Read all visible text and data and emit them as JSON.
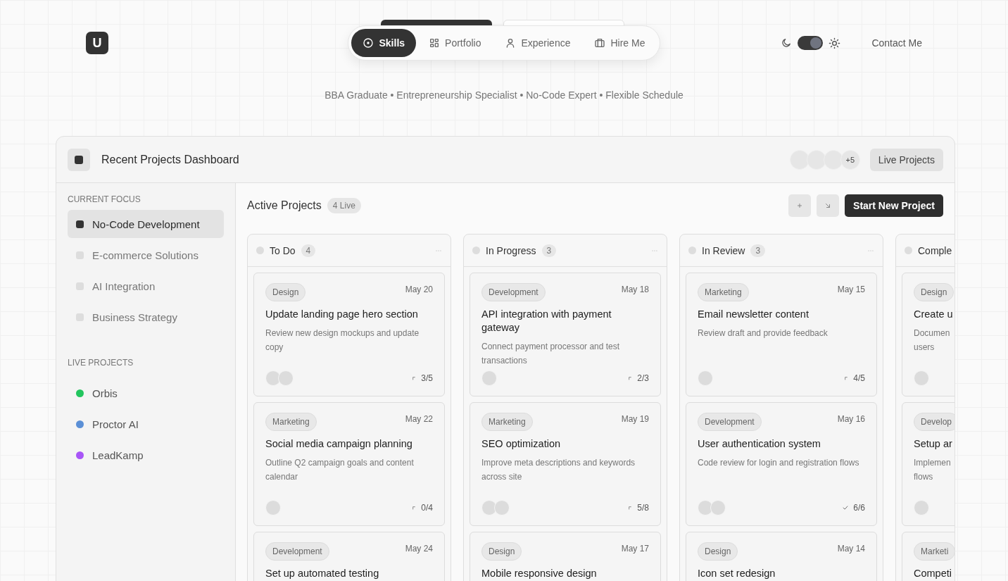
{
  "logo": {
    "letter": "U"
  },
  "nav": [
    {
      "label": "Skills",
      "selected": true
    },
    {
      "label": "Portfolio",
      "selected": false
    },
    {
      "label": "Experience",
      "selected": false
    },
    {
      "label": "Hire Me",
      "selected": false
    }
  ],
  "theme_toggle": {
    "on": true
  },
  "contact": {
    "label": "Contact Me"
  },
  "tagline": "BBA Graduate • Entrepreneurship Specialist • No-Code Expert • Flexible Schedule",
  "dashboard": {
    "title": "Recent Projects Dashboard",
    "team": {
      "avatars": [
        {
          "kind": "blank"
        },
        {
          "kind": "blank"
        },
        {
          "kind": "blank"
        }
      ],
      "more": "+5"
    },
    "live_button": "Live Projects",
    "sidebar": {
      "sections": [
        {
          "label": "CURRENT FOCUS",
          "kind": "focus",
          "items": [
            {
              "label": "No-Code Development",
              "selected": true
            },
            {
              "label": "E-commerce Solutions",
              "selected": false
            },
            {
              "label": "AI Integration",
              "selected": false
            },
            {
              "label": "Business Strategy",
              "selected": false
            }
          ]
        },
        {
          "label": "LIVE PROJECTS",
          "kind": "projects",
          "items": [
            {
              "label": "Orbis",
              "color": "#22c55e"
            },
            {
              "label": "Proctor AI",
              "color": "#5b8fd6"
            },
            {
              "label": "LeadKamp",
              "color": "#a855f7"
            }
          ]
        }
      ]
    },
    "board": {
      "title": "Active Projects",
      "badge": "4 Live",
      "new_button": "Start New Project",
      "columns": [
        {
          "title": "To Do",
          "count": "4",
          "cards": [
            {
              "tag": "Design",
              "date": "May 20",
              "title": "Update landing page hero section",
              "desc": "Review new design mockups and update copy",
              "avatars": [
                {
                  "kind": "blank"
                },
                {
                  "kind": "blank"
                }
              ],
              "progress": "3/5",
              "complete": false
            },
            {
              "tag": "Marketing",
              "date": "May 22",
              "title": "Social media campaign planning",
              "desc": "Outline Q2 campaign goals and content calendar",
              "avatars": [
                {
                  "kind": "blank"
                }
              ],
              "progress": "0/4",
              "complete": false
            },
            {
              "tag": "Development",
              "date": "May 24",
              "title": "Set up automated testing"
            }
          ]
        },
        {
          "title": "In Progress",
          "count": "3",
          "cards": [
            {
              "tag": "Development",
              "date": "May 18",
              "title": "API integration with payment gateway",
              "desc": "Connect payment processor and test transactions",
              "avatars": [
                {
                  "kind": "blank"
                }
              ],
              "progress": "2/3",
              "complete": false
            },
            {
              "tag": "Marketing",
              "date": "May 19",
              "title": "SEO optimization",
              "desc": "Improve meta descriptions and keywords across site",
              "avatars": [
                {
                  "kind": "blank"
                },
                {
                  "kind": "blank"
                }
              ],
              "progress": "5/8",
              "complete": false
            },
            {
              "tag": "Design",
              "date": "May 17",
              "title": "Mobile responsive design"
            }
          ]
        },
        {
          "title": "In Review",
          "count": "3",
          "cards": [
            {
              "tag": "Marketing",
              "date": "May 15",
              "title": "Email newsletter content",
              "desc": "Review draft and provide feedback",
              "avatars": [
                {
                  "kind": "blank"
                }
              ],
              "progress": "4/5",
              "complete": false
            },
            {
              "tag": "Development",
              "date": "May 16",
              "title": "User authentication system",
              "desc": "Code review for login and registration flows",
              "avatars": [
                {
                  "kind": "blank"
                },
                {
                  "kind": "blank"
                }
              ],
              "progress": "6/6",
              "complete": true
            },
            {
              "tag": "Design",
              "date": "May 14",
              "title": "Icon set redesign"
            }
          ]
        },
        {
          "title": "Comple",
          "cards": [
            {
              "tag": "Design",
              "title": "Create u",
              "desc": "Documen\nusers",
              "avatars": [
                {
                  "kind": "blank"
                }
              ]
            },
            {
              "tag": "Develop",
              "title": "Setup ar",
              "desc": "Implemen\nflows",
              "avatars": [
                {
                  "kind": "blank"
                }
              ]
            },
            {
              "tag": "Marketi",
              "title": "Competi"
            }
          ]
        }
      ]
    }
  }
}
